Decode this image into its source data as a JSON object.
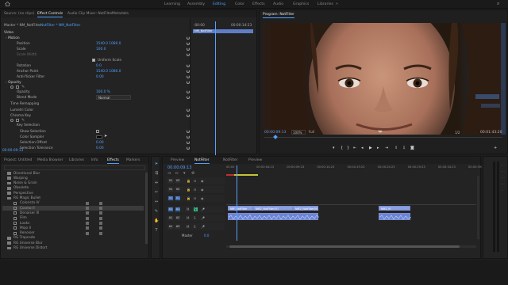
{
  "workspaces": [
    "Learning",
    "Assembly",
    "Editing",
    "Color",
    "Effects",
    "Audio",
    "Graphics",
    "Libraries"
  ],
  "active_workspace": "Editing",
  "source_tabs": [
    "Source: (no clips)",
    "Effect Controls",
    "Audio Clip Mixer: NotFilter",
    "Metadata"
  ],
  "ec": {
    "breadcrumb_master": "Master * NM_NotFilter",
    "breadcrumb_clip": "NotFilter * NM_NotFilter",
    "timecode_start": ":00:00",
    "timecode_end": "00:00:14:23",
    "clip_name": "NM_NotFilter",
    "section_video": "Video",
    "motion_label": "Motion",
    "props": [
      {
        "name": "Position",
        "value": "1540.0   1080.0"
      },
      {
        "name": "Scale",
        "value": "100.0"
      },
      {
        "name": "Scale Width",
        "value": ""
      },
      {
        "name": "",
        "value": "Uniform Scale"
      },
      {
        "name": "Rotation",
        "value": "0.0"
      },
      {
        "name": "Anchor Point",
        "value": "1540.0   1080.0"
      },
      {
        "name": "Anti-flicker Filter",
        "value": "0.00"
      }
    ],
    "opacity_label": "Opacity",
    "opacity_value": "100.0 %",
    "blend_label": "Blend Mode",
    "blend_value": "Normal",
    "time_remap": "Time Remapping",
    "lumetri": "Lumetri Color",
    "chroma": "Chroma Key",
    "key_props": [
      {
        "name": "Key Selection",
        "value": ""
      },
      {
        "name": "Show Selection",
        "value": "checkbox"
      },
      {
        "name": "Color Sampler",
        "value": "swatch"
      },
      {
        "name": "Selection Offset",
        "value": "0.00"
      },
      {
        "name": "Selection Tolerance",
        "value": "0.00"
      }
    ],
    "bottom_timecode": "00:00:09:13"
  },
  "program": {
    "title": "Program: NotFilter",
    "timecode": "00:00:09:13",
    "zoom": "100%",
    "quality": "Full",
    "fraction": "1/2",
    "duration": "00:01:43:20"
  },
  "project_tabs": [
    "Project: Untitled",
    "Media Browser",
    "Libraries",
    "Info",
    "Effects",
    "Markers"
  ],
  "effects_list": [
    {
      "label": "Directional Blur",
      "type": "folder"
    },
    {
      "label": "Warping",
      "type": "folder"
    },
    {
      "label": "Noise & Grain",
      "type": "folder"
    },
    {
      "label": "Obsolete",
      "type": "folder"
    },
    {
      "label": "Perspective",
      "type": "folder"
    },
    {
      "label": "RG Magic Bullet",
      "type": "folder"
    },
    {
      "label": "Colorista IV",
      "type": "item"
    },
    {
      "label": "Cosmo II",
      "type": "item",
      "selected": true
    },
    {
      "label": "Denoiser III",
      "type": "item"
    },
    {
      "label": "Film",
      "type": "item"
    },
    {
      "label": "Looks",
      "type": "item"
    },
    {
      "label": "Mojo II",
      "type": "item"
    },
    {
      "label": "Renoiser",
      "type": "item"
    },
    {
      "label": "RG Trapcode",
      "type": "folder"
    },
    {
      "label": "RG Universe Blur",
      "type": "folder"
    },
    {
      "label": "RG Universe Distort",
      "type": "folder"
    }
  ],
  "timeline": {
    "tabs": [
      "Preview",
      "NotFilter",
      "NotFilter",
      "Preview"
    ],
    "active_tab": 1,
    "timecode": "00:00:09:13",
    "ruler": [
      "00:00",
      "00:00:04:23",
      "00:00:09:23",
      "00:00:14:23",
      "00:00:19:23",
      "00:00:24:23",
      "00:00:29:23",
      "00:00:34:23",
      "00:00:39:23"
    ],
    "tracks": [
      "V3",
      "V2",
      "V1",
      "A1",
      "A2",
      "A3"
    ],
    "master_label": "Master",
    "master_value": "0.0",
    "clips": [
      {
        "label": "NM_NotFilter",
        "track": "V1"
      },
      {
        "label": "NM2_NotFilter[V]",
        "track": "V1"
      },
      {
        "label": "NM2_NotFilter[V]",
        "track": "V1"
      },
      {
        "label": "NM2_N",
        "track": "V1"
      }
    ]
  },
  "colors": {
    "accent": "#4ea0ff",
    "video_clip": "#8a9fe3",
    "audio_clip": "#6b84d6",
    "playhead": "#5aa0ff",
    "work_area": "#c5c43a"
  }
}
